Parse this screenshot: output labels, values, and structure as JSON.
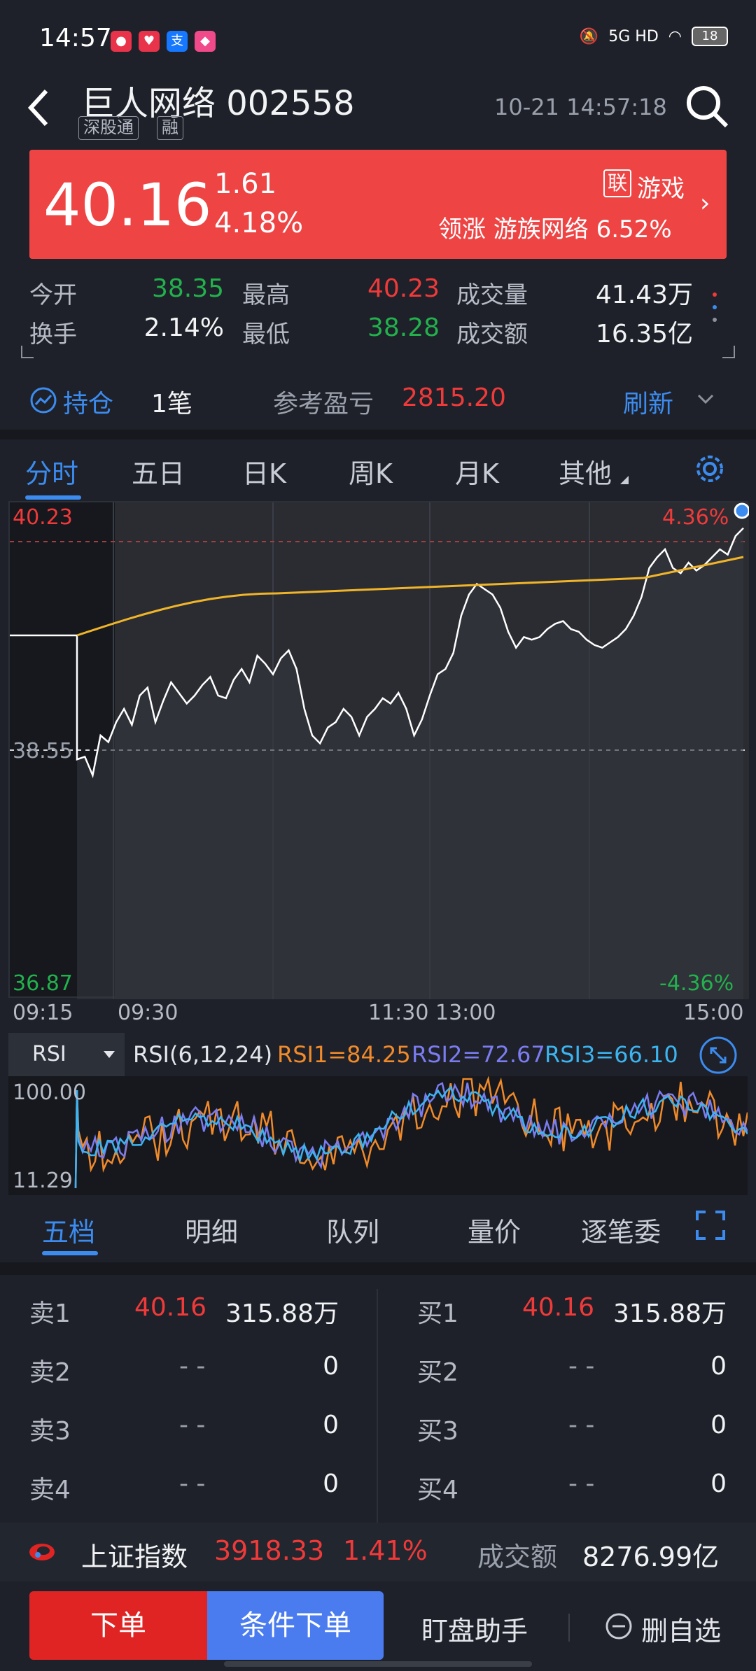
{
  "status_bar": {
    "time": "14:57",
    "network": "5G HD",
    "battery": "18"
  },
  "header": {
    "title": "巨人网络 002558",
    "tags": [
      "深股通",
      "融"
    ],
    "timestamp": "10-21 14:57:18"
  },
  "banner": {
    "price": "40.16",
    "change": "1.61",
    "change_pct": "4.18%",
    "lian_badge": "联",
    "industry": "游戏",
    "leader": "领涨 游族网络 6.52%"
  },
  "stats": {
    "open_label": "今开",
    "open": "38.35",
    "high_label": "最高",
    "high": "40.23",
    "volume_label": "成交量",
    "volume": "41.43万",
    "turnover_label": "换手",
    "turnover": "2.14%",
    "low_label": "最低",
    "low": "38.28",
    "amount_label": "成交额",
    "amount": "16.35亿"
  },
  "position": {
    "label": "持仓",
    "count": "1笔",
    "pl_label": "参考盈亏",
    "pl_value": "2815.20",
    "refresh": "刷新"
  },
  "chart_tabs": [
    "分时",
    "五日",
    "日K",
    "周K",
    "月K",
    "其他"
  ],
  "chart": {
    "y_top": "40.23",
    "y_mid": "38.55",
    "y_bottom": "36.87",
    "pct_top": "4.36%",
    "pct_bottom": "-4.36%",
    "times": [
      "09:15",
      "09:30",
      "11:30 13:00",
      "15:00"
    ]
  },
  "rsi": {
    "select": "RSI",
    "params": "RSI(6,12,24)",
    "rsi1": "RSI1=84.25",
    "rsi2": "RSI2=72.67",
    "rsi3": "RSI3=66.10",
    "top": "100.00",
    "bottom": "11.29"
  },
  "book_tabs": [
    "五档",
    "明细",
    "队列",
    "量价",
    "逐笔委"
  ],
  "order_book": {
    "sell": [
      {
        "label": "卖1",
        "price": "40.16",
        "vol": "315.88万"
      },
      {
        "label": "卖2",
        "price": "- -",
        "vol": "0"
      },
      {
        "label": "卖3",
        "price": "- -",
        "vol": "0"
      },
      {
        "label": "卖4",
        "price": "- -",
        "vol": "0"
      }
    ],
    "buy": [
      {
        "label": "买1",
        "price": "40.16",
        "vol": "315.88万"
      },
      {
        "label": "买2",
        "price": "- -",
        "vol": "0"
      },
      {
        "label": "买3",
        "price": "- -",
        "vol": "0"
      },
      {
        "label": "买4",
        "price": "- -",
        "vol": "0"
      }
    ]
  },
  "index_bar": {
    "name": "上证指数",
    "value": "3918.33",
    "pct": "1.41%",
    "amount_label": "成交额",
    "amount": "8276.99亿"
  },
  "bottom": {
    "order": "下单",
    "cond_order": "条件下单",
    "assistant": "盯盘助手",
    "remove": "删自选"
  },
  "colors": {
    "up": "#f03a3a",
    "down": "#22b14c",
    "accent": "#3c8cf0",
    "avg_line": "#f0b429",
    "rsi1": "#f08a2a",
    "rsi2": "#7b7cf0",
    "rsi3": "#3cb4f0"
  }
}
